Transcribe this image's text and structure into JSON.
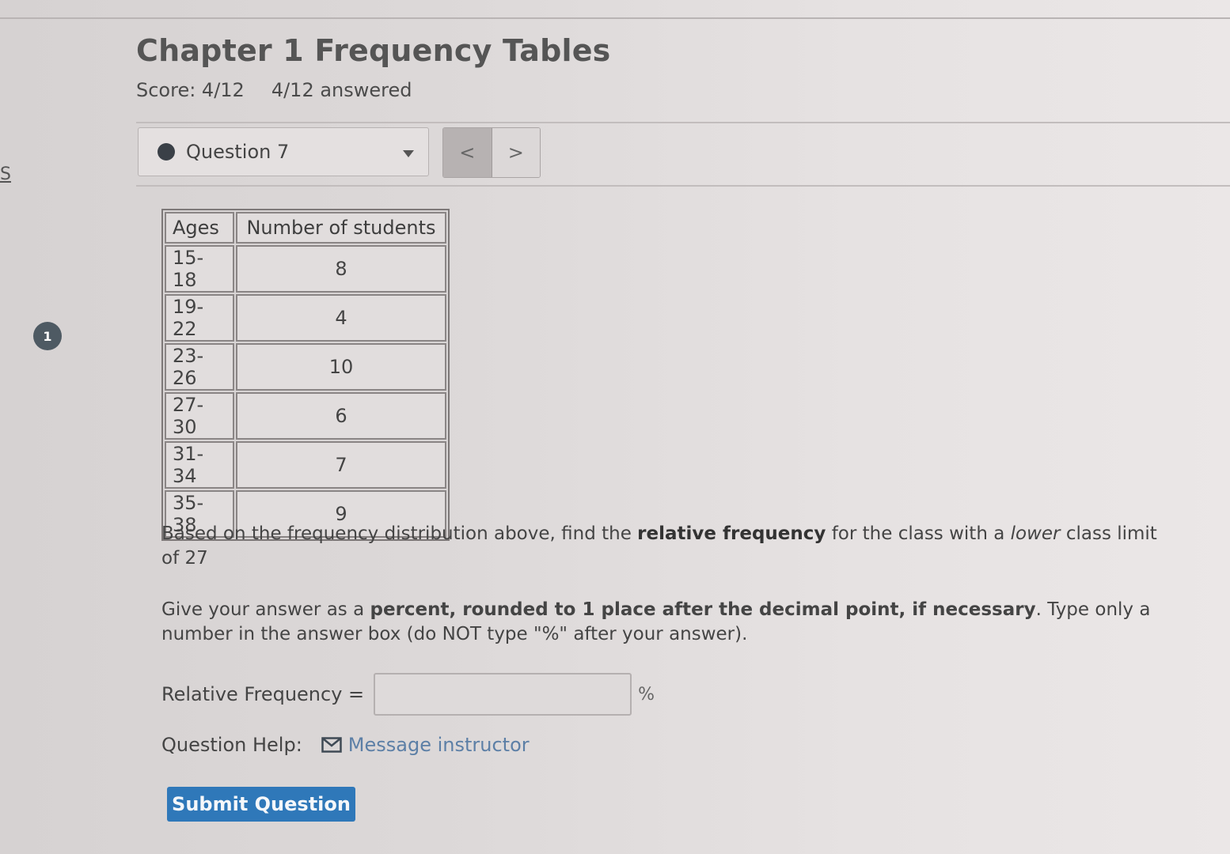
{
  "page": {
    "title": "Chapter 1 Frequency Tables",
    "score": "Score: 4/12",
    "answered": "4/12 answered"
  },
  "sidebar": {
    "letter": "S",
    "badge": "1"
  },
  "question_nav": {
    "selected": "Question 7",
    "prev_label": "<",
    "next_label": ">"
  },
  "table": {
    "headers": [
      "Ages",
      "Number of students"
    ],
    "rows": [
      {
        "age": "15-18",
        "count": "8"
      },
      {
        "age": "19-22",
        "count": "4"
      },
      {
        "age": "23-26",
        "count": "10"
      },
      {
        "age": "27-30",
        "count": "6"
      },
      {
        "age": "31-34",
        "count": "7"
      },
      {
        "age": "35-38",
        "count": "9"
      }
    ]
  },
  "question": {
    "p1_part1": "Based on the frequency distribution above, find the ",
    "p1_bold": "relative frequency",
    "p1_part2": " for the class with a ",
    "p1_italic": "lower",
    "p1_part3": " class limit of 27",
    "p2_part1": "Give your answer as a ",
    "p2_bold": "percent, rounded to 1 place after the decimal point, if necessary",
    "p2_part2": ". Type only a number in the answer box (do NOT type \"%\" after your answer).",
    "answer_label": "Relative Frequency =",
    "answer_value": "",
    "unit": "%"
  },
  "help": {
    "label": "Question Help:",
    "link": "Message instructor",
    "icon": "mail-icon"
  },
  "submit_label": "Submit Question",
  "colors": {
    "submit": "#2f78b9",
    "link": "#5c7fa6",
    "badge": "#4e5a63"
  }
}
